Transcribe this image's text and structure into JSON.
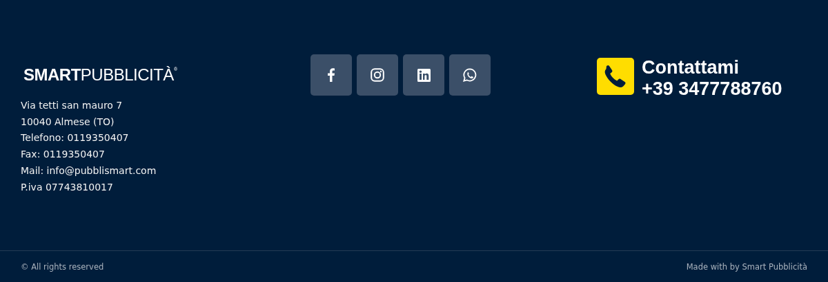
{
  "brand": {
    "logo": "**SMART**PUBBLICITÀ$^{®}$",
    "address_lines": [
      "Via tetti san mauro 7",
      "10040 Almese (TO)",
      "Telefono: 0119350407",
      "Fax: 0119350407",
      "Mail: info@pubblismart.com",
      "P.iva 07743810017"
    ]
  },
  "social_links": [
    {
      "kind": "facebook"
    },
    {
      "kind": "instagram"
    },
    {
      "kind": "linkedin"
    },
    {
      "kind": "whatsapp"
    }
  ],
  "contact": {
    "title": "Contattami",
    "phone": "+39 3477788760"
  },
  "bottom_bar": {
    "copyright": "© All rights reserved",
    "credit": "Made with by Smart Pubblicità"
  }
}
